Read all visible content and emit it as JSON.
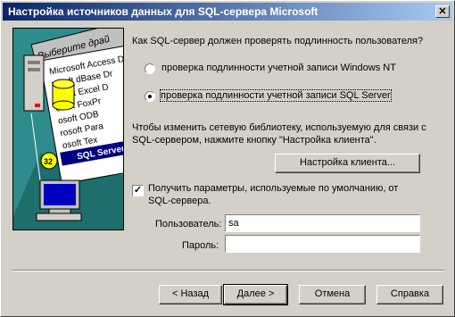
{
  "window": {
    "title": "Настройка источников данных для SQL-сервера Microsoft",
    "close_glyph": "✕"
  },
  "art": {
    "heading": "Выберите драй",
    "items": [
      "Microsoft Access D",
      "rosoft dBase Dr",
      "rosoft Excel D",
      "osoft FoxPr",
      "osoft ODB",
      "rosoft Para",
      "osoft Tex"
    ],
    "sql_label": "SQL Server",
    "badge": "32",
    "colors": {
      "teal": "#2e8c8c",
      "navy": "#000080",
      "yellow": "#ffff00"
    }
  },
  "question": "Как SQL-сервер должен проверять подлинность пользователя?",
  "auth_options": [
    {
      "label": "проверка подлинности учетной записи Windows NT",
      "selected": false
    },
    {
      "label": "проверка подлинности учетной записи SQL Server",
      "selected": true
    }
  ],
  "network_text_line1": "Чтобы изменить сетевую библиотеку, используемую для связи с",
  "network_text_line2": "SQL-сервером, нажмите кнопку \"Настройка клиента\".",
  "client_button": "Настройка клиента...",
  "defaults_checkbox": {
    "line1": "Получить параметры, используемые по умолчанию, от",
    "line2": "SQL-сервера.",
    "checked": true,
    "glyph": "✓"
  },
  "login": {
    "label": "Пользователь:",
    "value": "sa"
  },
  "password": {
    "label": "Пароль:",
    "value": ""
  },
  "buttons": {
    "back": "< Назад",
    "next": "Далее >",
    "cancel": "Отмена",
    "help": "Справка"
  }
}
